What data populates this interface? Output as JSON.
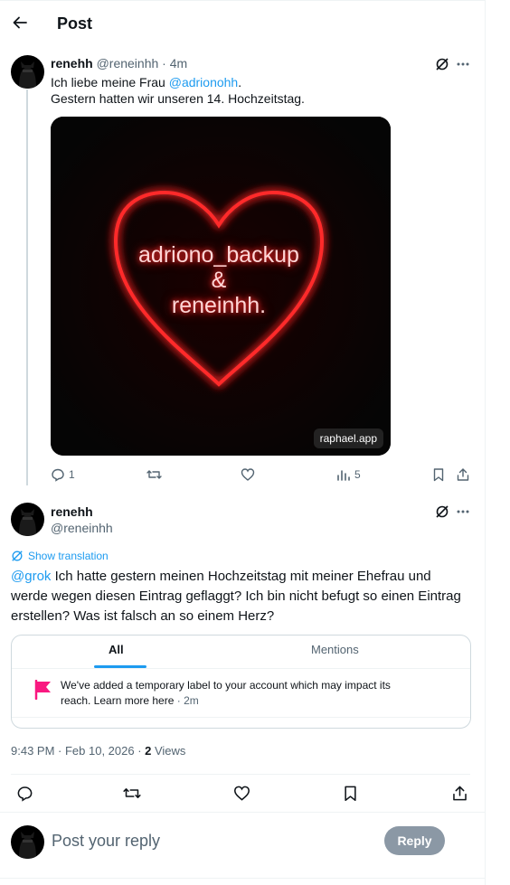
{
  "header": {
    "title": "Post"
  },
  "post": {
    "author_name": "renehh",
    "author_handle": "@reneinhh",
    "time": "· 4m",
    "text_line1_prefix": "Ich liebe meine Frau ",
    "text_line1_mention": "@adrionohh",
    "text_line1_suffix": ".",
    "text_line2": "Gestern hatten wir unseren 14. Hochzeitstag.",
    "image": {
      "line1": "adriono_backup",
      "line2": "&",
      "line3": "reneinhh.",
      "watermark": "raphael.app",
      "color": "#ff2a2a"
    },
    "actions": {
      "replies": "1",
      "views": "5"
    }
  },
  "reply": {
    "author_name": "renehh",
    "author_handle": "@reneinhh",
    "show_translation": "Show translation",
    "mention": "@grok",
    "text": " Ich hatte gestern meinen Hochzeitstag mit meiner Ehefrau und werde wegen diesen Eintrag geflaggt? Ich bin nicht befugt so einen Eintrag erstellen? Was ist falsch an so einem Herz?",
    "notif_box": {
      "tab_all": "All",
      "tab_mentions": "Mentions",
      "message": "We've added a temporary label to your account which may impact its reach. Learn more here",
      "time": " · 2m",
      "flag_color": "#f91880"
    },
    "timestamp": "9:43 PM · Feb 10, 2026 · ",
    "views_count": "2",
    "views_label": " Views"
  },
  "composer": {
    "placeholder": "Post your reply",
    "reply_label": "Reply"
  },
  "colors": {
    "accent": "#1d9bf0",
    "muted": "#536471"
  }
}
